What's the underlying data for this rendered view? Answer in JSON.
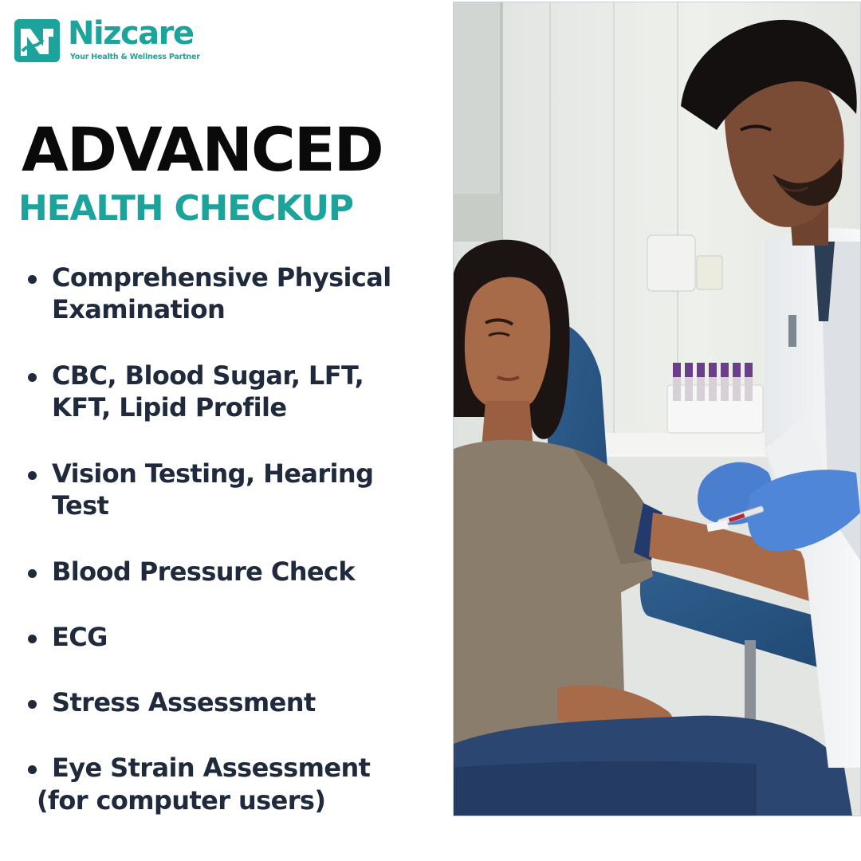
{
  "brand": {
    "name": "Nizcare",
    "tagline": "Your Health & Wellness Partner",
    "color": "#1ba39c"
  },
  "headline": "ADVANCED",
  "subheadline": "HEALTH CHECKUP",
  "checklist": [
    {
      "text": "Comprehensive Physical\nExamination"
    },
    {
      "text": "CBC, Blood Sugar, LFT,\nKFT, Lipid Profile"
    },
    {
      "text": "Vision Testing, Hearing\nTest"
    },
    {
      "text": "Blood Pressure Check"
    },
    {
      "text": "ECG"
    },
    {
      "text": "Stress Assessment"
    },
    {
      "text": "Eye Strain Assessment",
      "note": "(for computer users)"
    }
  ],
  "photo": {
    "icon": "photo-doctor-drawing-blood"
  },
  "colors": {
    "text_dark": "#1f2a3c",
    "heading_black": "#0a0a0a",
    "accent_teal": "#1ba39c"
  }
}
